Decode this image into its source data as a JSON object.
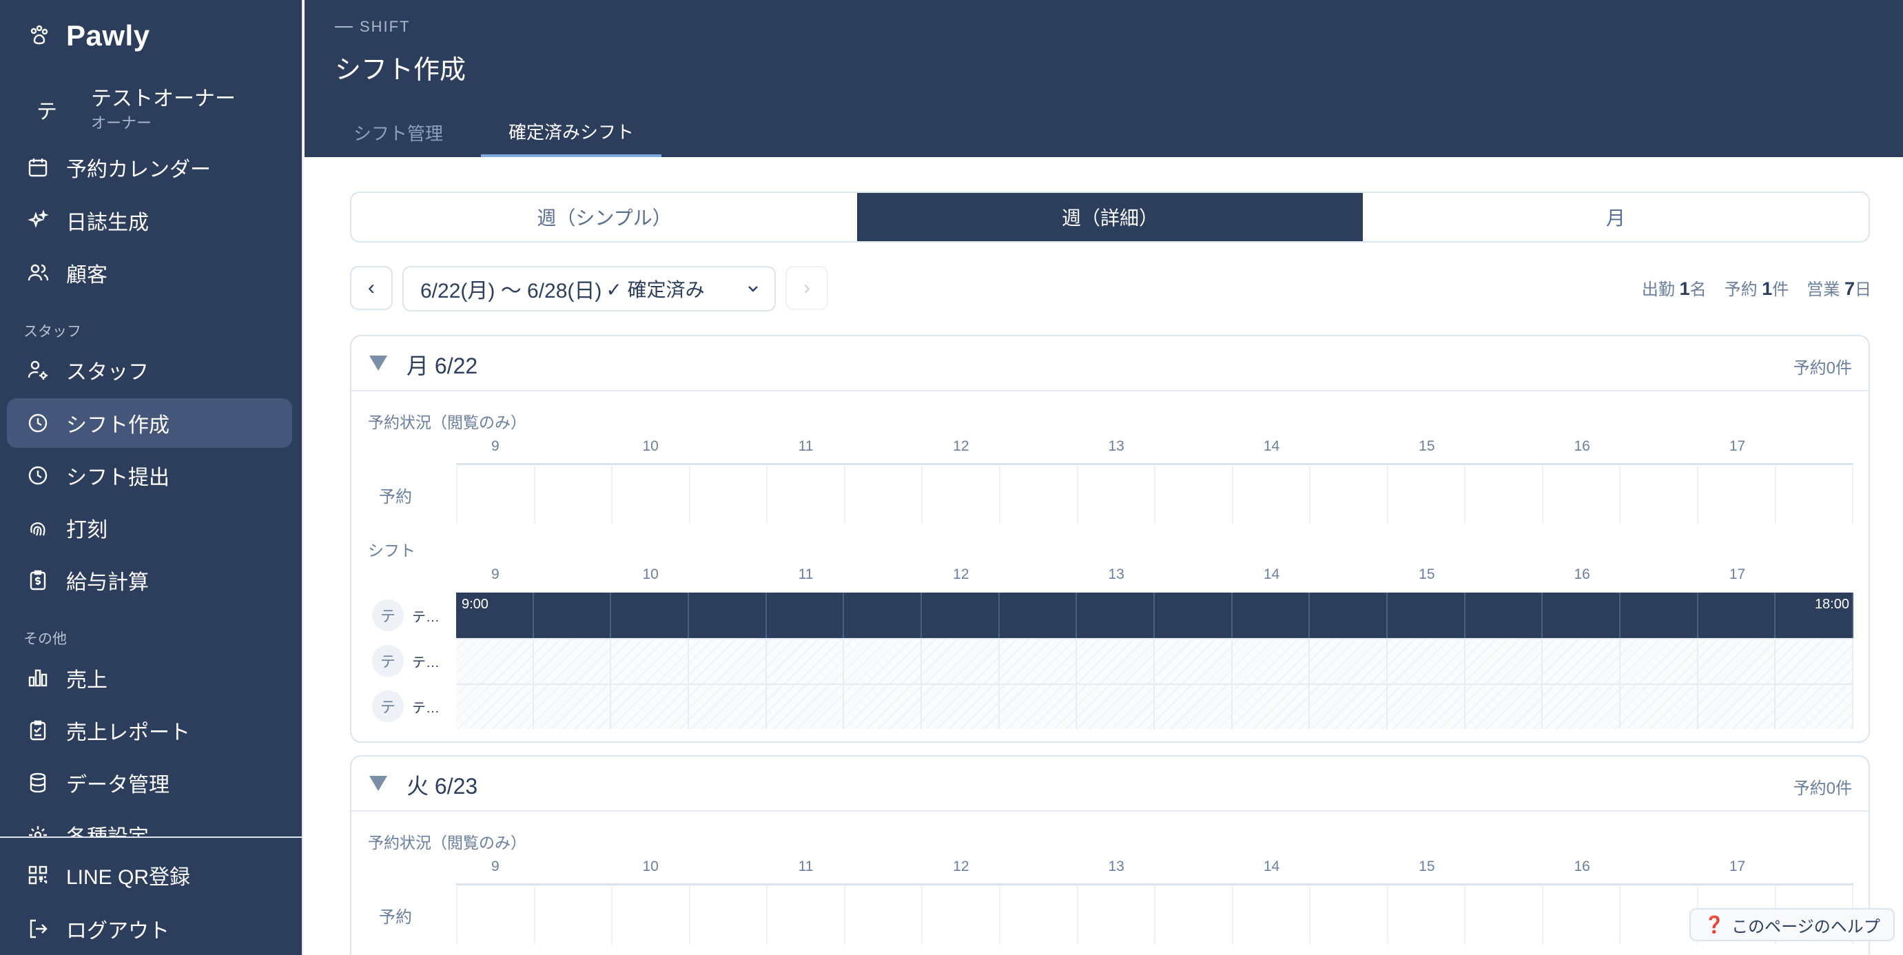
{
  "brand": {
    "name": "Pawly"
  },
  "user": {
    "initial": "テ",
    "name": "テストオーナー",
    "role": "オーナー"
  },
  "nav": {
    "items_top": [
      {
        "label": "予約カレンダー",
        "icon": "calendar-icon"
      },
      {
        "label": "日誌生成",
        "icon": "sparkles-icon"
      },
      {
        "label": "顧客",
        "icon": "users-icon"
      }
    ],
    "section_staff": "スタッフ",
    "items_staff": [
      {
        "label": "スタッフ",
        "icon": "user-gear-icon"
      },
      {
        "label": "シフト作成",
        "icon": "clock-icon",
        "active": true
      },
      {
        "label": "シフト提出",
        "icon": "clock-icon"
      },
      {
        "label": "打刻",
        "icon": "fingerprint-icon"
      },
      {
        "label": "給与計算",
        "icon": "payroll-icon"
      }
    ],
    "section_other": "その他",
    "items_other": [
      {
        "label": "売上",
        "icon": "bar-chart-icon"
      },
      {
        "label": "売上レポート",
        "icon": "clipboard-icon"
      },
      {
        "label": "データ管理",
        "icon": "database-icon"
      },
      {
        "label": "各種設定",
        "icon": "gear-icon"
      }
    ],
    "items_bottom": [
      {
        "label": "LINE QR登録",
        "icon": "qr-icon"
      },
      {
        "label": "ログアウト",
        "icon": "logout-icon"
      }
    ]
  },
  "header": {
    "eyebrow": "SHIFT",
    "title": "シフト作成",
    "tabs": [
      {
        "label": "シフト管理",
        "active": false
      },
      {
        "label": "確定済みシフト",
        "active": true
      }
    ]
  },
  "view_modes": [
    {
      "label": "週（シンプル）",
      "active": false
    },
    {
      "label": "週（詳細）",
      "active": true
    },
    {
      "label": "月",
      "active": false
    }
  ],
  "range": {
    "prev": "‹",
    "next": "›",
    "label": "6/22(月) 〜 6/28(日)",
    "status": "✓ 確定済み"
  },
  "stats": {
    "attend_label": "出勤",
    "attend_value": "1",
    "attend_unit": "名",
    "booking_label": "予約",
    "booking_value": "1",
    "booking_unit": "件",
    "open_label": "営業",
    "open_value": "7",
    "open_unit": "日"
  },
  "hours": [
    "9",
    "10",
    "11",
    "12",
    "13",
    "14",
    "15",
    "16",
    "17"
  ],
  "days": [
    {
      "label": "月 6/22",
      "count": "予約0件",
      "booking_section": "予約状況（閲覧のみ）",
      "booking_row": "予約",
      "shift_section": "シフト",
      "staff": [
        {
          "initial": "テ",
          "name": "テ…",
          "start": "9:00",
          "end": "18:00"
        },
        {
          "initial": "テ",
          "name": "テ…"
        },
        {
          "initial": "テ",
          "name": "テ…"
        }
      ]
    },
    {
      "label": "火 6/23",
      "count": "予約0件",
      "booking_section": "予約状況（閲覧のみ）",
      "booking_row": "予約"
    }
  ],
  "help": {
    "label": "このページのヘルプ",
    "icon": "❓"
  }
}
